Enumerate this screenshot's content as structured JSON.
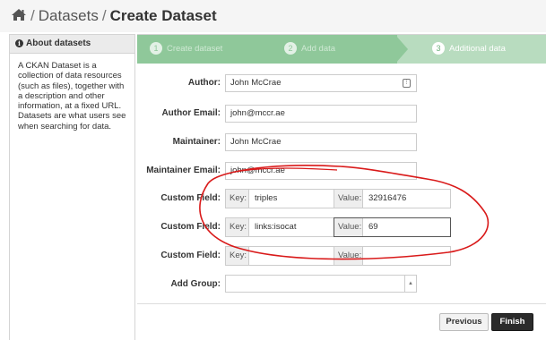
{
  "breadcrumb": {
    "home_icon": "home-icon",
    "items": [
      "Datasets",
      "Create Dataset"
    ],
    "separator": "/"
  },
  "sidebar": {
    "title": "About datasets",
    "icon": "info-icon",
    "body": "A CKAN Dataset is a collection of data resources (such as files), together with a description and other information, at a fixed URL. Datasets are what users see when searching for data."
  },
  "stages": [
    {
      "number": "1",
      "label": "Create dataset",
      "state": "complete"
    },
    {
      "number": "2",
      "label": "Add data",
      "state": "complete"
    },
    {
      "number": "3",
      "label": "Additional data",
      "state": "active"
    }
  ],
  "form": {
    "author": {
      "label": "Author:",
      "value": "John McCrae"
    },
    "author_email": {
      "label": "Author Email:",
      "value": "john@mccr.ae"
    },
    "maintainer": {
      "label": "Maintainer:",
      "value": "John McCrae"
    },
    "maintainer_email": {
      "label": "Maintainer Email:",
      "value": "john@mccr.ae"
    },
    "custom_fields": [
      {
        "label": "Custom Field:",
        "key_addon": "Key:",
        "key": "triples",
        "value_addon": "Value:",
        "value": "32916476"
      },
      {
        "label": "Custom Field:",
        "key_addon": "Key:",
        "key": "links:isocat",
        "value_addon": "Value:",
        "value": "69"
      },
      {
        "label": "Custom Field:",
        "key_addon": "Key:",
        "key": "",
        "value_addon": "Value:",
        "value": ""
      }
    ],
    "add_group": {
      "label": "Add Group:",
      "value": ""
    }
  },
  "buttons": {
    "previous": "Previous",
    "finish": "Finish"
  },
  "colors": {
    "stage_complete": "#8fc89a",
    "stage_active": "#b8dcbf",
    "annotation": "#d91a1a",
    "finish_button": "#2b2b2b"
  }
}
